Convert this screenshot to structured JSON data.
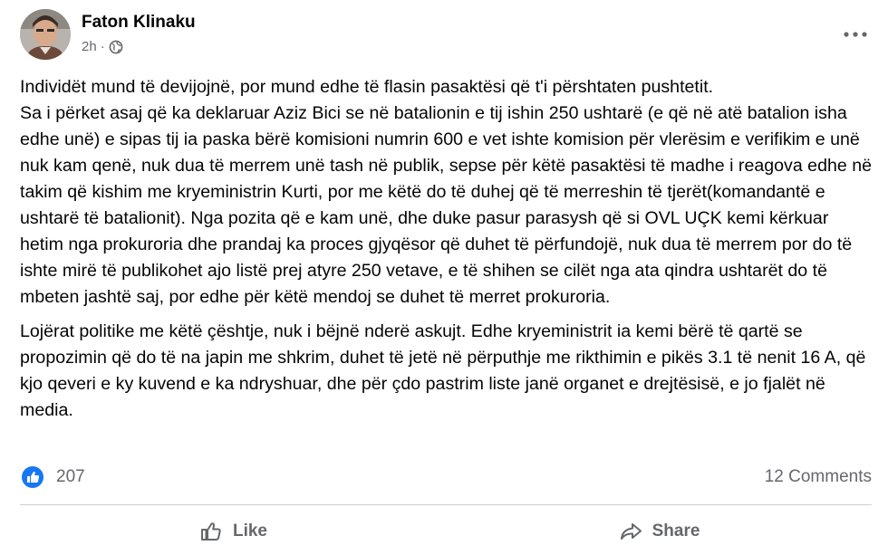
{
  "post": {
    "author": "Faton Klinaku",
    "time": "2h",
    "separator": "·",
    "privacy_icon": "globe-icon",
    "paragraphs": [
      "Individët mund të devijojnë, por mund edhe të flasin pasaktësi që t'i përshtaten pushtetit.\nSa i përket asaj që ka deklaruar Aziz Bici se në batalionin e tij ishin 250 ushtarë (e që në atë batalion isha edhe unë) e sipas tij ia paska bërë komisioni numrin 600 e vet ishte komision për vlerësim e verifikim e unë nuk kam qenë, nuk dua të merrem unë tash në publik, sepse për këtë pasaktësi të madhe i reagova edhe në takim që kishim me kryeministrin Kurti, por me këtë do të duhej që të merreshin të tjerët(komandantë e ushtarë të batalionit). Nga pozita që e kam unë, dhe duke pasur parasysh që si OVL UÇK kemi kërkuar hetim nga prokuroria dhe prandaj ka proces gjyqësor që duhet të përfundojë, nuk dua të merrem por do të ishte mirë të publikohet ajo listë prej atyre 250 vetave, e të shihen se cilët nga ata qindra ushtarët do të mbeten jashtë saj, por edhe për këtë mendoj se duhet të merret prokuroria.",
      "Lojërat politike me këtë çështje, nuk i bëjnë nderë askujt. Edhe kryeministrit ia kemi bërë të qartë se propozimin që do të na japin me shkrim, duhet të jetë në përputhje me rikthimin e pikës 3.1 të nenit 16 A, që kjo qeveri e ky kuvend e ka ndryshuar, dhe për çdo pastrim liste janë organet e drejtësisë, e jo fjalët në media."
    ]
  },
  "stats": {
    "reactions_count": "207",
    "comments": "12 Comments"
  },
  "actions": {
    "like_label": "Like",
    "share_label": "Share"
  },
  "colors": {
    "text": "#050505",
    "secondary": "#65676b",
    "like_blue": "#1877f2",
    "divider": "#ced0d4"
  }
}
